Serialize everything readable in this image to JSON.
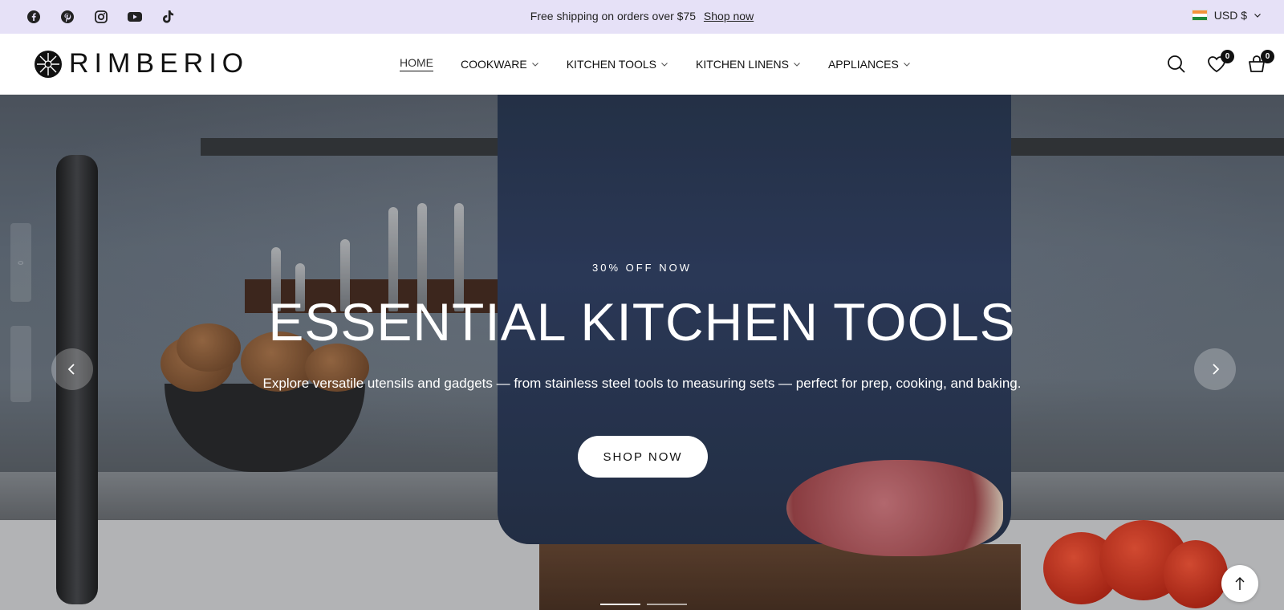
{
  "topbar": {
    "social_icons": [
      "facebook-icon",
      "pinterest-icon",
      "instagram-icon",
      "youtube-icon",
      "tiktok-icon"
    ],
    "announcement": "Free shipping on orders over $75",
    "announcement_link": "Shop now",
    "currency": "USD $"
  },
  "header": {
    "logo": "RIMBERIO",
    "nav": [
      {
        "label": "HOME",
        "active": true,
        "dropdown": false
      },
      {
        "label": "COOKWARE",
        "dropdown": true
      },
      {
        "label": "KITCHEN TOOLS",
        "dropdown": true
      },
      {
        "label": "KITCHEN LINENS",
        "dropdown": true
      },
      {
        "label": "APPLIANCES",
        "dropdown": true
      }
    ],
    "wishlist_count": "0",
    "cart_count": "0"
  },
  "hero": {
    "eyebrow": "30% OFF NOW",
    "title": "ESSENTIAL KITCHEN TOOLS",
    "subtitle": "Explore versatile utensils and gadgets — from stainless steel tools to measuring sets — perfect for prep, cooking, and baking.",
    "cta": "SHOP NOW",
    "side_compare_count": "0"
  },
  "colors": {
    "topbar_bg": "#e6e1f7",
    "text": "#111111",
    "badge": "#111111"
  }
}
